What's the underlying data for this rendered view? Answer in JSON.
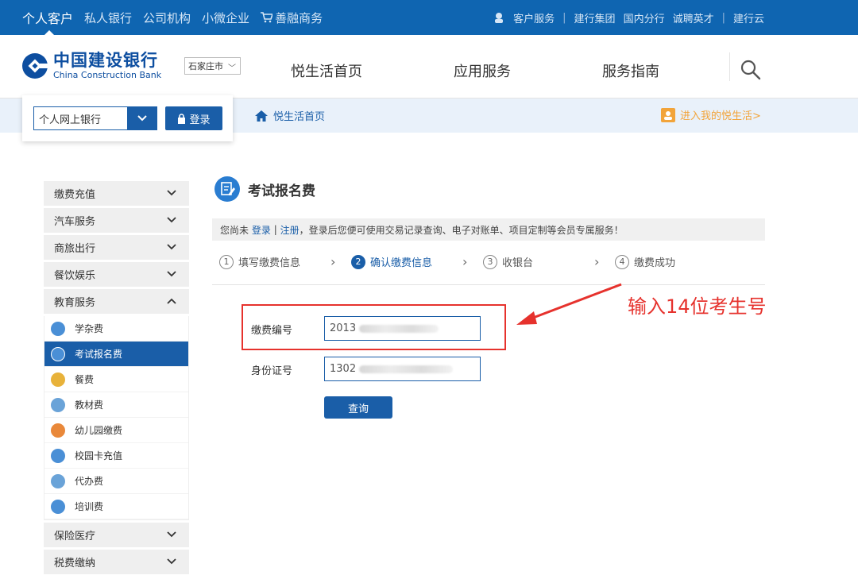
{
  "topbar": {
    "left_items": [
      "个人客户",
      "私人银行",
      "公司机构",
      "小微企业",
      "善融商务"
    ],
    "active_item": "个人客户",
    "right_items": [
      "客户服务",
      "建行集团",
      "国内分行",
      "诚聘英才",
      "建行云"
    ]
  },
  "header": {
    "logo_cn": "中国建设银行",
    "logo_en": "China Construction Bank",
    "city": "石家庄市",
    "nav": [
      "悦生活首页",
      "应用服务",
      "服务指南"
    ],
    "brand_color": "#0f65b1"
  },
  "login": {
    "select_value": "个人网上银行",
    "login_label": "登录"
  },
  "breadcrumb": {
    "home": "悦生活首页",
    "mylife": "进入我的悦生活>"
  },
  "sidebar": {
    "categories_top": [
      "缴费充值",
      "汽车服务",
      "商旅出行",
      "餐饮娱乐"
    ],
    "expanded": "教育服务",
    "sub_items": [
      {
        "label": "学杂费",
        "icon": "graduation-cap-icon",
        "color": "#4a8fd6"
      },
      {
        "label": "考试报名费",
        "icon": "edit-form-icon",
        "color": "#4a8fd6"
      },
      {
        "label": "餐费",
        "icon": "food-icon",
        "color": "#e8b23a"
      },
      {
        "label": "教材费",
        "icon": "book-icon",
        "color": "#6aa3d8"
      },
      {
        "label": "幼儿园缴费",
        "icon": "child-icon",
        "color": "#e9883a"
      },
      {
        "label": "校园卡充值",
        "icon": "card-icon",
        "color": "#4a8fd6"
      },
      {
        "label": "代办费",
        "icon": "agent-icon",
        "color": "#6aa3d8"
      },
      {
        "label": "培训费",
        "icon": "training-icon",
        "color": "#4a8fd6"
      }
    ],
    "active_sub": "考试报名费",
    "categories_bottom": [
      "保险医疗",
      "税费缴纳"
    ]
  },
  "main": {
    "title": "考试报名费",
    "notice_prefix": "您尚未",
    "notice_login": "登录",
    "notice_sep": "|",
    "notice_register": "注册",
    "notice_suffix": "，登录后您便可使用交易记录查询、电子对账单、项目定制等会员专属服务！",
    "steps": [
      {
        "num": "1",
        "label": "填写缴费信息"
      },
      {
        "num": "2",
        "label": "确认缴费信息"
      },
      {
        "num": "3",
        "label": "收银台"
      },
      {
        "num": "4",
        "label": "缴费成功"
      }
    ],
    "active_step": 2,
    "form": {
      "payment_no_label": "缴费编号",
      "payment_no_value": "2013",
      "id_label": "身份证号",
      "id_value": "1302",
      "query_label": "查询"
    },
    "annotation": "输入14位考生号",
    "annotation_color": "#e6322d"
  }
}
